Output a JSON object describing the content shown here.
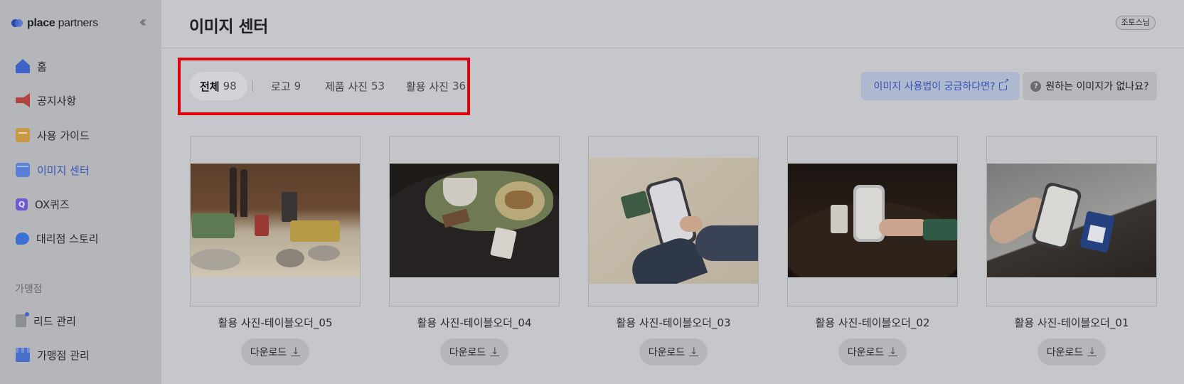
{
  "sidebar": {
    "logo": {
      "bold": "place",
      "light": " partners"
    },
    "collapse_icon": "chevrons-left-icon",
    "items": [
      {
        "label": "홈",
        "icon": "home-icon"
      },
      {
        "label": "공지사항",
        "icon": "megaphone-icon"
      },
      {
        "label": "사용 가이드",
        "icon": "book-icon"
      },
      {
        "label": "이미지 센터",
        "icon": "image-folder-icon",
        "active": true
      },
      {
        "label": "OX퀴즈",
        "icon": "quiz-icon"
      },
      {
        "label": "대리점 스토리",
        "icon": "chat-bubble-icon"
      }
    ],
    "section_label": "가맹점",
    "section_items": [
      {
        "label": "리드 관리",
        "icon": "document-icon"
      },
      {
        "label": "가맹점 관리",
        "icon": "store-icon"
      }
    ]
  },
  "header": {
    "title": "이미지 센터",
    "user_badge": "조토스님"
  },
  "tabs": [
    {
      "name": "전체",
      "count": "98",
      "active": true
    },
    {
      "name": "로고",
      "count": "9"
    },
    {
      "name": "제품 사진",
      "count": "53"
    },
    {
      "name": "활용 사진",
      "count": "36"
    }
  ],
  "actions": {
    "help_label": "이미지 사용법이 궁금하다면?",
    "request_label": "원하는 이미지가 없나요?",
    "request_icon_glyph": "?"
  },
  "cards": [
    {
      "title": "활용 사진-테이블오더_05",
      "download_label": "다운로드"
    },
    {
      "title": "활용 사진-테이블오더_04",
      "download_label": "다운로드"
    },
    {
      "title": "활용 사진-테이블오더_03",
      "download_label": "다운로드"
    },
    {
      "title": "활용 사진-테이블오더_02",
      "download_label": "다운로드"
    },
    {
      "title": "활용 사진-테이블오더_01",
      "download_label": "다운로드"
    }
  ],
  "colors": {
    "accent": "#3a57b8",
    "highlight_box": "#e0000e",
    "overlay_bg": "#c6c7ca"
  }
}
